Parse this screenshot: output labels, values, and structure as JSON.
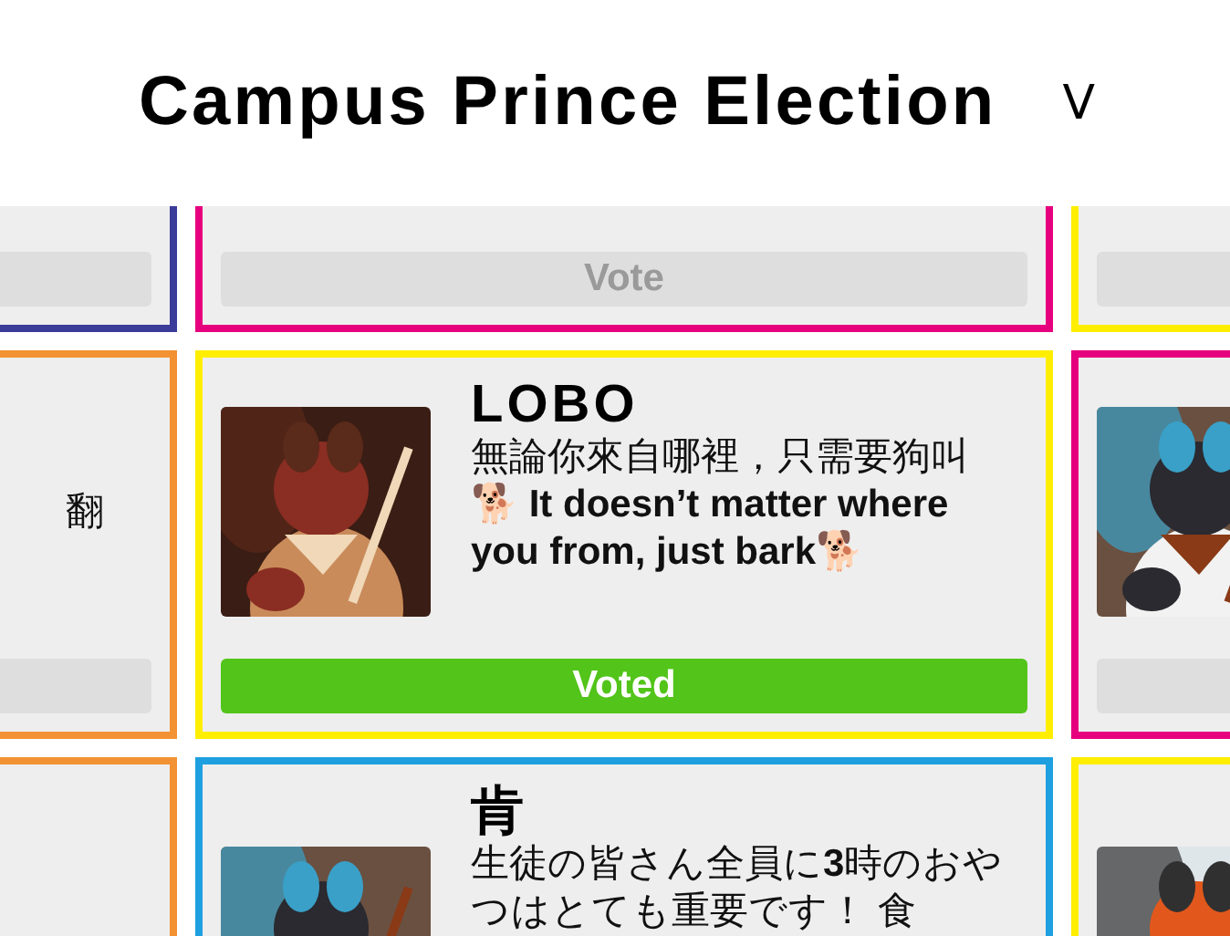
{
  "header": {
    "title": "Campus Prince Election",
    "toggle": "V"
  },
  "cards": [
    {
      "kind": "edge_left",
      "color": "#3b3b9a",
      "button": {
        "voted": false
      }
    },
    {
      "kind": "full",
      "color": "#e6007e",
      "button": {
        "voted": false,
        "label": "Vote"
      }
    },
    {
      "kind": "edge_right",
      "color": "#ffee00",
      "button": {
        "voted": false
      }
    },
    {
      "kind": "edge_left",
      "color": "#f39233",
      "description": "翻",
      "button": {
        "voted": false
      }
    },
    {
      "kind": "full",
      "color": "#ffee00",
      "name": "LOBO",
      "description": "無論你來自哪裡，只需要狗叫 **🐕 It doesn’t matter where you from, just bark🐕**",
      "button": {
        "voted": true,
        "label": "Voted"
      }
    },
    {
      "kind": "edge_right",
      "color": "#e6007e",
      "button": {
        "voted": false
      }
    },
    {
      "kind": "edge_left",
      "color": "#f39233"
    },
    {
      "kind": "full",
      "color": "#1ea0e0",
      "name": "肯",
      "description": "生徒の皆さん全員に**3**時のおやつはとても重要です！ 食"
    },
    {
      "kind": "edge_right",
      "color": "#ffee00"
    }
  ]
}
